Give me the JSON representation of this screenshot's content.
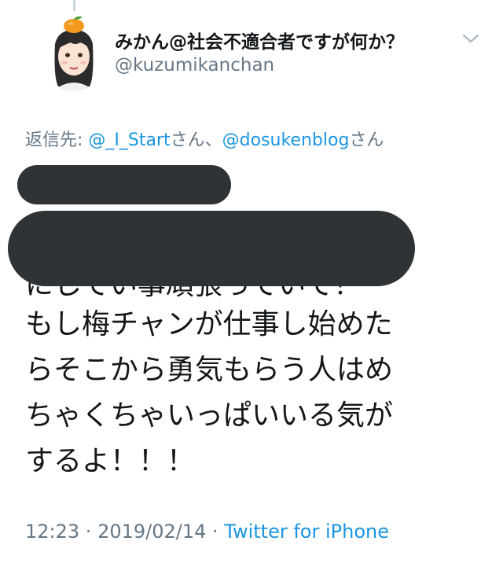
{
  "author": {
    "display_name": "みかん@社会不適合者ですが何か？",
    "handle": "@kuzumikanchan"
  },
  "icons": {
    "avatar": "orange-haired-girl-avatar",
    "menu": "chevron-down-icon"
  },
  "reply": {
    "prefix": "返信先: ",
    "mention_1": "@_I_Start",
    "suffix_1": "さん、",
    "mention_2": "@dosukenblog",
    "suffix_2": "さん"
  },
  "tweet": {
    "partial_line": "にしてい事頑張っていて！",
    "lines": [
      "もし梅チャンが仕事し始めた",
      "らそこから勇気もらう人はめ",
      "ちゃくちゃいっぱいいる気が",
      "するよ！！！"
    ]
  },
  "meta": {
    "time": "12:23",
    "separator": " · ",
    "date": "2019/02/14",
    "source": "Twitter for iPhone"
  },
  "colors": {
    "text": "#14171a",
    "secondary": "#657786",
    "link": "#1b95e0",
    "redaction": "#2f3336"
  }
}
